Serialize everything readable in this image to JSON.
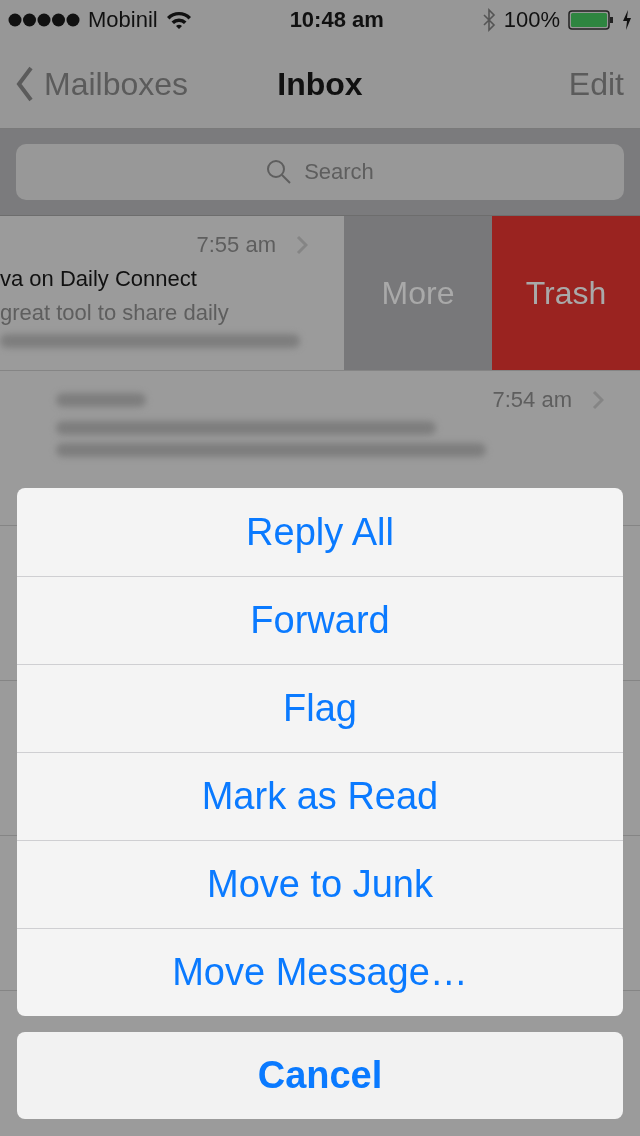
{
  "status_bar": {
    "carrier": "Mobinil",
    "time": "10:48 am",
    "battery": "100%"
  },
  "nav": {
    "back": "Mailboxes",
    "title": "Inbox",
    "action": "Edit"
  },
  "search": {
    "placeholder": "Search"
  },
  "messages": [
    {
      "time": "7:55 am",
      "subject": "va on Daily Connect",
      "preview": "great tool to share daily",
      "actions": [
        {
          "label": "More",
          "kind": "more"
        },
        {
          "label": "Trash",
          "kind": "trash"
        }
      ]
    },
    {
      "time": "7:54 am"
    }
  ],
  "action_sheet": {
    "actions": [
      "Reply All",
      "Forward",
      "Flag",
      "Mark as Read",
      "Move to Junk",
      "Move Message…"
    ],
    "cancel": "Cancel"
  }
}
